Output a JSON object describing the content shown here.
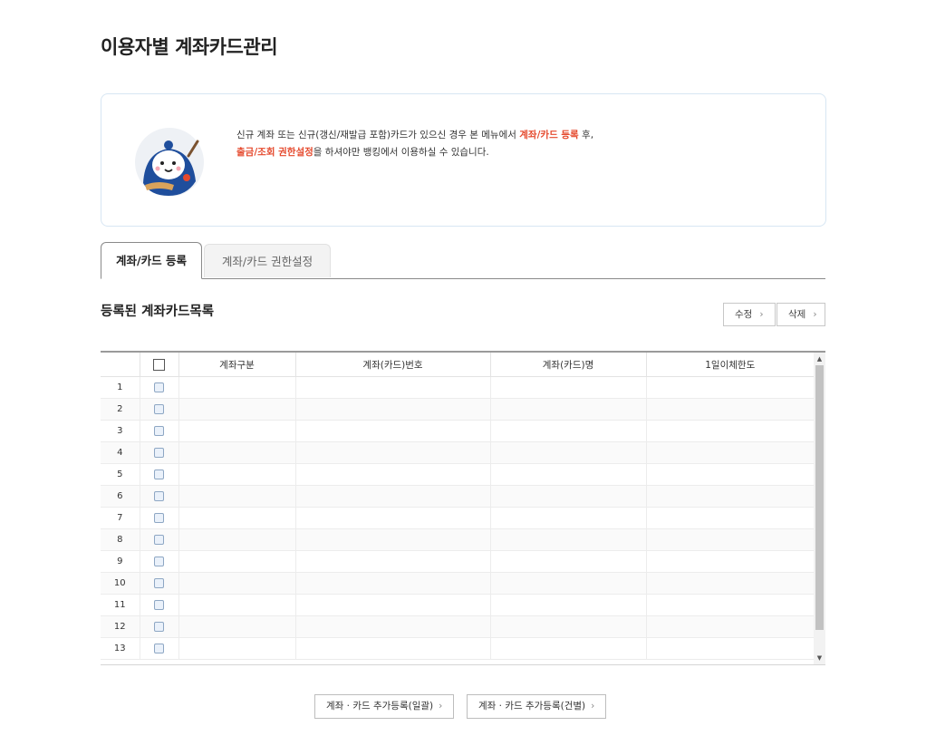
{
  "page": {
    "title": "이용자별 계좌카드관리"
  },
  "notice": {
    "line1_prefix": "신규 계좌 또는 신규(갱신/재발급 포함)카드가 있으신 경우 본 메뉴에서 ",
    "line1_highlight": "계좌/카드 등록",
    "line1_suffix": " 후,",
    "line2_highlight": "출금/조회 권한설정",
    "line2_suffix": "을 하셔야만 뱅킹에서 이용하실 수 있습니다.",
    "highlight_color": "#e5492d",
    "mascot_icon": "mascot-character"
  },
  "tabs": [
    {
      "label": "계좌/카드 등록",
      "active": true
    },
    {
      "label": "계좌/카드 권한설정",
      "active": false
    }
  ],
  "section": {
    "title": "등록된 계좌카드목록",
    "edit_label": "수정",
    "delete_label": "삭제"
  },
  "grid": {
    "columns": [
      "",
      "",
      "계좌구분",
      "계좌(카드)번호",
      "계좌(카드)명",
      "1일이체한도"
    ],
    "rows": [
      "1",
      "2",
      "3",
      "4",
      "5",
      "6",
      "7",
      "8",
      "9",
      "10",
      "11",
      "12",
      "13"
    ]
  },
  "actions": {
    "bulk_label": "계좌 · 카드 추가등록(일괄)",
    "single_label": "계좌 · 카드 추가등록(건별)"
  }
}
